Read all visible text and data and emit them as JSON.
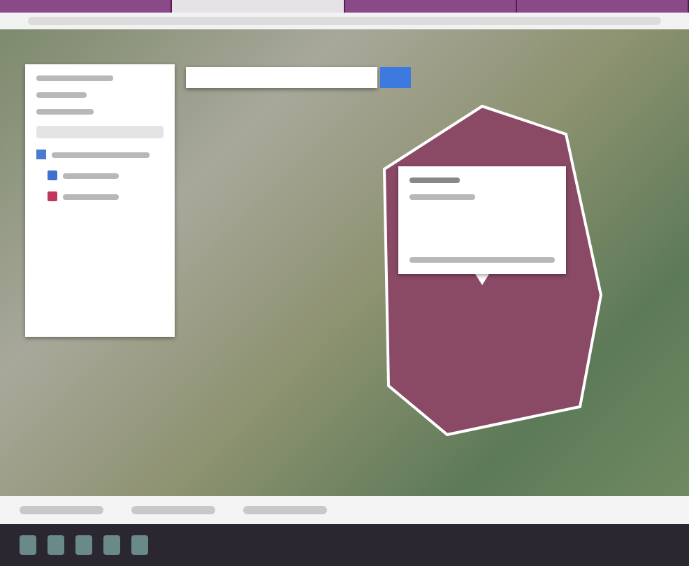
{
  "browser": {
    "tabs": [
      {
        "selected": false
      },
      {
        "selected": true
      },
      {
        "selected": false
      },
      {
        "selected": false
      }
    ]
  },
  "layers_panel": {
    "layers": [
      {
        "checked": true,
        "features": [
          {
            "color": "#3f6fd1"
          },
          {
            "color": "#c2355f"
          }
        ]
      }
    ]
  },
  "polygon": {
    "color": "#8a4a66",
    "selected": true
  }
}
